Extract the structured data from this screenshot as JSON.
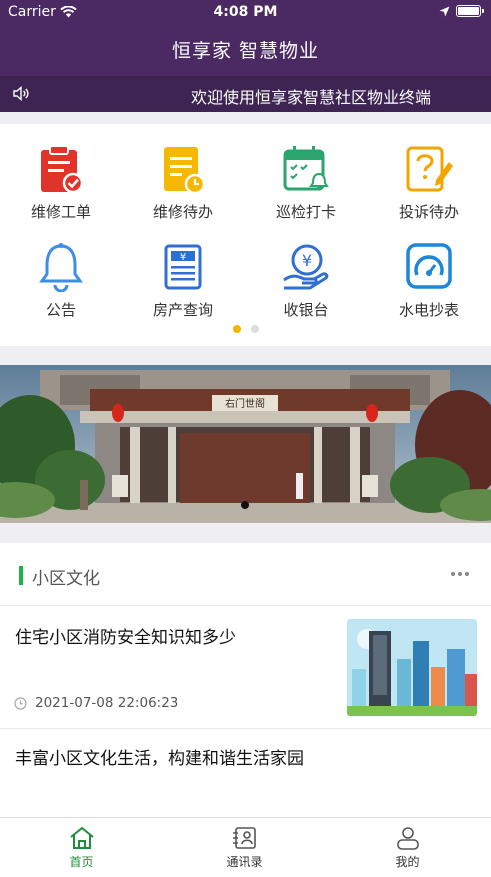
{
  "status_bar": {
    "carrier": "Carrier",
    "time": "4:08 PM"
  },
  "header": {
    "title": "恒享家 智慧物业"
  },
  "notice": {
    "text": "欢迎使用恒享家智慧社区物业终端"
  },
  "menu": {
    "items": [
      {
        "label": "维修工单",
        "icon": "repair-order-icon",
        "color": "#e0332a"
      },
      {
        "label": "维修待办",
        "icon": "repair-todo-icon",
        "color": "#f5b800"
      },
      {
        "label": "巡检打卡",
        "icon": "inspection-calendar-icon",
        "color": "#2aa56e"
      },
      {
        "label": "投诉待办",
        "icon": "complaint-icon",
        "color": "#f5a400"
      },
      {
        "label": "公告",
        "icon": "bell-icon",
        "color": "#3d8ee8"
      },
      {
        "label": "房产查询",
        "icon": "property-query-icon",
        "color": "#2f6fd1"
      },
      {
        "label": "收银台",
        "icon": "cashier-icon",
        "color": "#2f6fd1"
      },
      {
        "label": "水电抄表",
        "icon": "meter-icon",
        "color": "#1e86d6"
      }
    ],
    "page_count": 2,
    "active_page": 0
  },
  "banner": {
    "sign_text": "右门世阁"
  },
  "culture": {
    "title": "小区文化",
    "articles": [
      {
        "title": "住宅小区消防安全知识知多少",
        "time": "2021-07-08 22:06:23"
      },
      {
        "title": "丰富小区文化生活，构建和谐生活家园"
      }
    ]
  },
  "tabbar": {
    "items": [
      {
        "label": "首页",
        "icon": "home-icon"
      },
      {
        "label": "通讯录",
        "icon": "contacts-icon"
      },
      {
        "label": "我的",
        "icon": "profile-icon"
      }
    ],
    "active": 0
  },
  "colors": {
    "header": "#4b2a63",
    "notice_bar": "#3d2452",
    "accent": "#1db24a",
    "dot_active": "#f2b400"
  }
}
